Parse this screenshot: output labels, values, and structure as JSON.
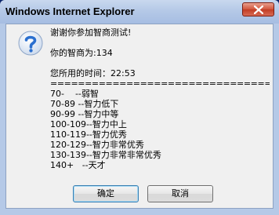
{
  "window": {
    "title": "Windows Internet Explorer"
  },
  "dialog": {
    "icon": "question-icon",
    "lines": [
      "谢谢你参加智商测试!",
      "",
      "你的智商为:134",
      "",
      "您所用的时间：22:53",
      "==========================================",
      "70-    --弱智",
      "70-89 --智力低下",
      "90-99 --智力中等",
      "100-109--智力中上",
      "110-119--智力优秀",
      "120-129--智力非常优秀",
      "130-139--智力非常非常优秀",
      "140+   --天才"
    ]
  },
  "buttons": {
    "ok_label": "确定",
    "cancel_label": "取消"
  },
  "colors": {
    "titlebar": "#b5c9e7",
    "close_button": "#c13c24",
    "client_bg": "#f0f0f0",
    "icon_blue": "#2a6fcf"
  }
}
